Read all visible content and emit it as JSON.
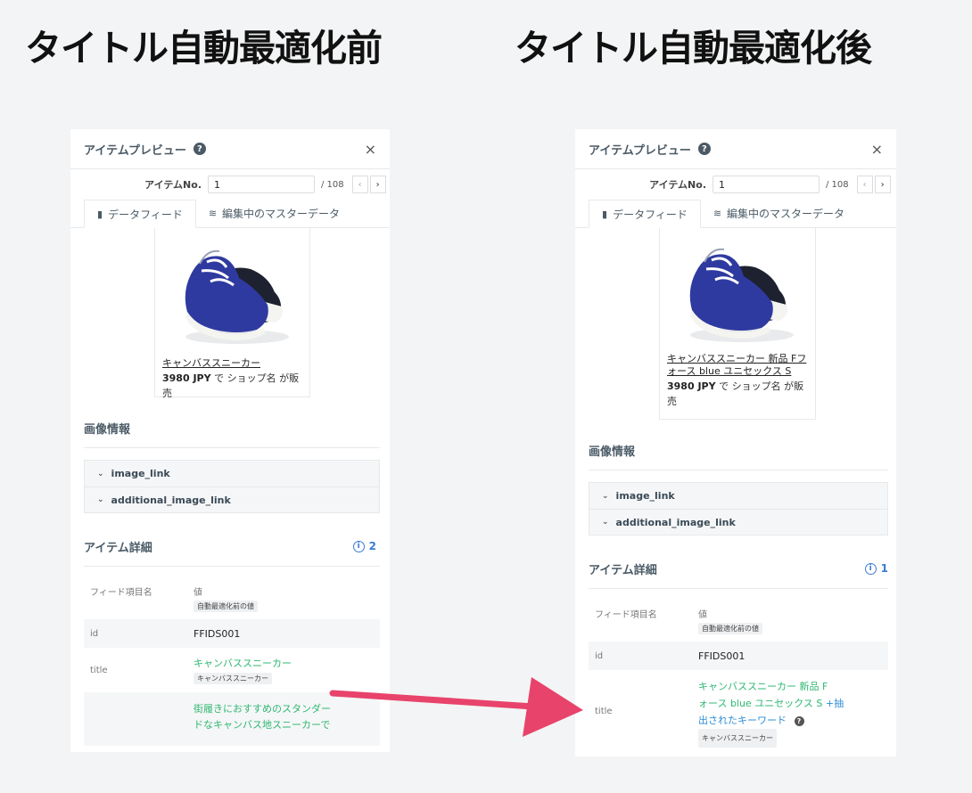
{
  "headings": {
    "before": "タイトル自動最適化前",
    "after": "タイトル自動最適化後"
  },
  "panel": {
    "title": "アイテムプレビュー",
    "help_glyph": "?",
    "close_glyph": "×",
    "item_no_label": "アイテムNo.",
    "item_no_value": "1",
    "item_total": "/ 108",
    "prev_glyph": "‹",
    "next_glyph": "›",
    "tabs": [
      "データフィード",
      "編集中のマスターデータ"
    ],
    "image_section": "画像情報",
    "image_fields": [
      "image_link",
      "additional_image_link"
    ],
    "details_section": "アイテム詳細",
    "col_name": "フィード項目名",
    "col_value": "値",
    "col_value_sub": "自動最適化前の値",
    "price_bold": "3980 JPY",
    "price_rest": " で ショップ名 が販売",
    "id_label": "id",
    "id_value": "FFIDS001",
    "title_label": "title",
    "original_title": "キャンバススニーカー"
  },
  "before": {
    "product_title": "キャンバススニーカー",
    "detail_count": "2",
    "title_value": "キャンバススニーカー",
    "description_line1": "街履きにおすすめのスタンダー",
    "description_line2": "ドなキャンバス地スニーカーで"
  },
  "after": {
    "product_title_line1": "キャンバススニーカー 新品 Fフ",
    "product_title_line2": "ォース blue ユニセックス S",
    "detail_count": "1",
    "title_value_line1": "キャンバススニーカー 新品 F",
    "title_value_line2": "ォース blue ユニセックス S",
    "title_added_plus": "+抽",
    "title_added_line2": "出されたキーワード"
  },
  "colors": {
    "accent_green": "#2eb872",
    "accent_blue": "#2d8ed6",
    "arrow": "#e8436b"
  }
}
